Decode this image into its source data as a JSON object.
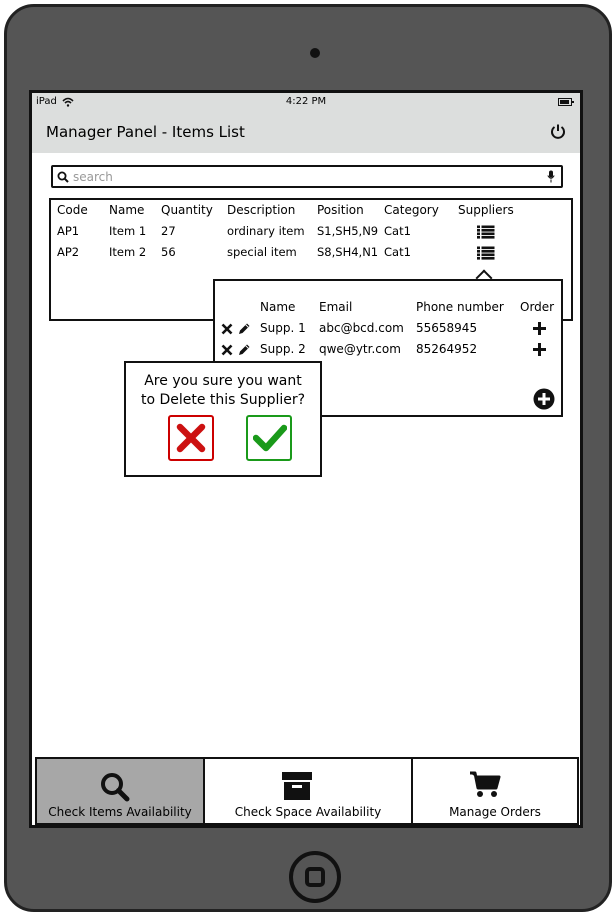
{
  "statusbar": {
    "carrier": "iPad",
    "time": "4:22 PM"
  },
  "header": {
    "title": "Manager Panel - Items List"
  },
  "search": {
    "placeholder": "search"
  },
  "items_table": {
    "headers": [
      "Code",
      "Name",
      "Quantity",
      "Description",
      "Position",
      "Category",
      "Suppliers"
    ],
    "rows": [
      [
        "AP1",
        "Item 1",
        "27",
        "ordinary item",
        "S1,SH5,N9",
        "Cat1"
      ],
      [
        "AP2",
        "Item 2",
        "56",
        "special item",
        "S8,SH4,N1",
        "Cat1"
      ]
    ]
  },
  "suppliers_popup": {
    "headers": [
      "Name",
      "Email",
      "Phone number",
      "Order"
    ],
    "rows": [
      [
        "Supp. 1",
        "abc@bcd.com",
        "55658945"
      ],
      [
        "Supp. 2",
        "qwe@ytr.com",
        "85264952"
      ]
    ]
  },
  "confirm_dialog": {
    "line1": "Are you sure you want",
    "line2": "to Delete this Supplier?"
  },
  "tabs": [
    {
      "label": "Check Items Availability",
      "icon": "search-icon",
      "active": true
    },
    {
      "label": "Check Space Availability",
      "icon": "archive-box-icon",
      "active": false
    },
    {
      "label": "Manage Orders",
      "icon": "shopping-cart-icon",
      "active": false
    }
  ],
  "colors": {
    "header_bg": "#dcdedd",
    "active_tab_bg": "#a7a7a7",
    "cancel": "#cc1111",
    "confirm": "#1a9a1a"
  }
}
